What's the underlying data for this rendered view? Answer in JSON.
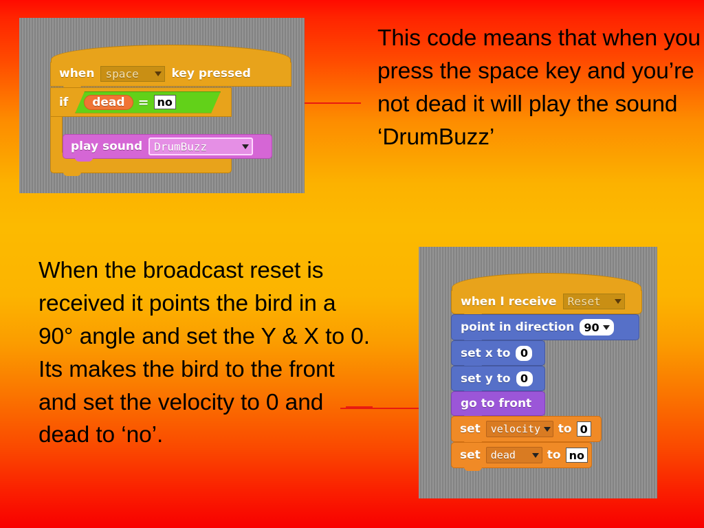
{
  "slide": {
    "background_top_color": "#ff0a00",
    "background_mid_color": "#fcb400",
    "background_bottom_color": "#f80000",
    "arrow_color": "#e81a10"
  },
  "text_blocks": {
    "top_right": "This code means that when you press the space key and you’re not dead it will play the sound ‘DrumBuzz’",
    "bottom_left": "When the broadcast reset is received  it points the bird in a 90° angle and set the Y & X to 0. Its makes the bird to the front and set the velocity to 0 and dead to ‘no’."
  },
  "script_one": {
    "panel_label": "scratch-script-key-pressed",
    "blocks": {
      "hat": {
        "prefix": "when",
        "dropdown_value": "space",
        "suffix": "key pressed"
      },
      "if_block": {
        "keyword": "if",
        "operand_left": "dead",
        "operator": "=",
        "operand_right": "no"
      },
      "play_sound": {
        "label": "play sound",
        "dropdown_value": "DrumBuzz"
      }
    }
  },
  "script_two": {
    "panel_label": "scratch-script-broadcast-reset",
    "blocks": {
      "hat": {
        "label": "when I receive",
        "dropdown_value": "Reset"
      },
      "point_in_direction": {
        "label": "point in direction",
        "value": "90"
      },
      "set_x": {
        "label": "set x to",
        "value": "0"
      },
      "set_y": {
        "label": "set y to",
        "value": "0"
      },
      "go_to_front": {
        "label": "go to front"
      },
      "set_velocity": {
        "prefix": "set",
        "variable": "velocity",
        "middle": "to",
        "value": "0"
      },
      "set_dead": {
        "prefix": "set",
        "variable": "dead",
        "middle": "to",
        "value": "no"
      }
    }
  }
}
